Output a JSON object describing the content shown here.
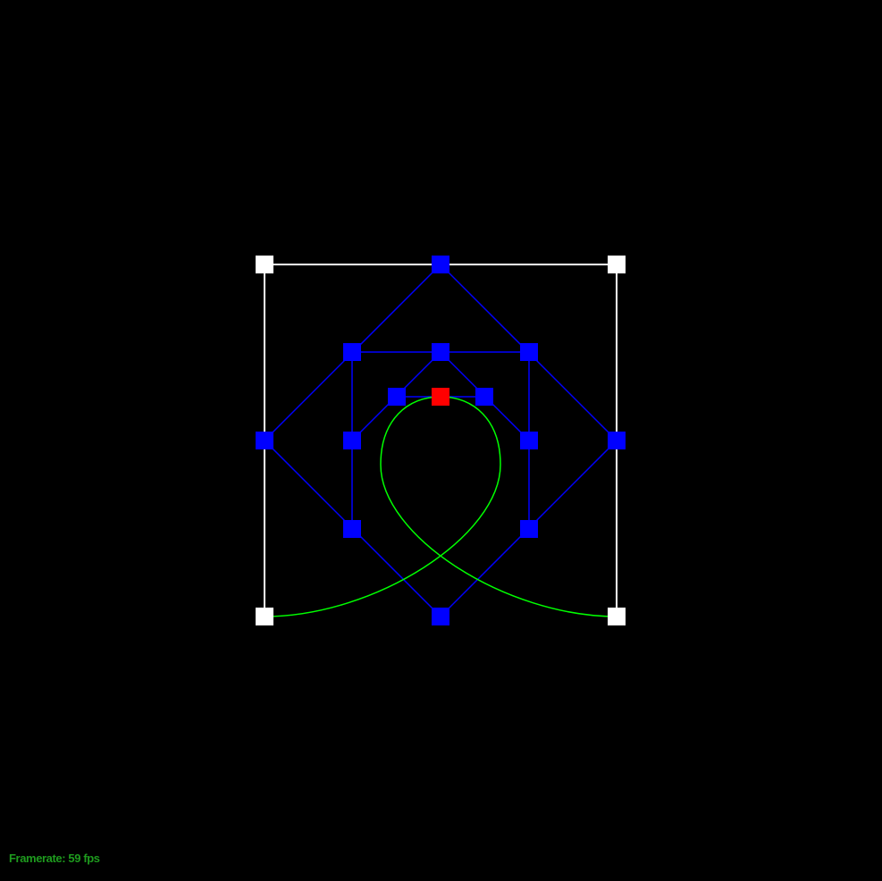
{
  "scene": {
    "background_color": "#000000",
    "control_point_color": "#FFFFFF",
    "construction_color": "#0000FF",
    "curve_point_color": "#FF0000",
    "curve_color": "#00FF00"
  },
  "status": {
    "label": "Framerate:",
    "value": "59",
    "unit": "fps",
    "color": "#1E9B1E"
  }
}
